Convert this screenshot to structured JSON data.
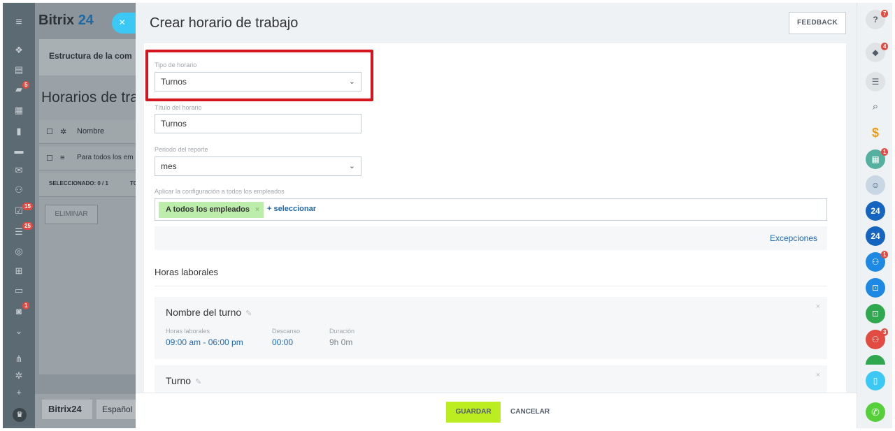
{
  "left_rail": {
    "badges": [
      "5",
      "15",
      "25",
      "1"
    ]
  },
  "background": {
    "logo": "Bitrix",
    "logo_num": "24",
    "close_icon": "×",
    "structure_label": "Estructura de la com",
    "page_title": "Horarios de tra",
    "header_name": "Nombre",
    "row_text": "Para todos los em",
    "selected_text": "SELECCIONADO: 0 / 1",
    "total_text": "TO",
    "delete_button": "ELIMINAR",
    "footer_logo": "Bitrix24",
    "footer_lang": "Español"
  },
  "slider": {
    "title": "Crear horario de trabajo",
    "feedback": "FEEDBACK"
  },
  "form": {
    "schedule_type_label": "Tipo de horario",
    "schedule_type_value": "Turnos",
    "schedule_title_label": "Título del horario",
    "schedule_title_value": "Turnos",
    "report_period_label": "Periodo del reporte",
    "report_period_value": "mes",
    "apply_label": "Aplicar la configuración a todos los empleados",
    "all_employees_tag": "A todos los empleados",
    "select_link": "+ seleccionar",
    "exceptions_link": "Excepciones",
    "working_hours_heading": "Horas laborales"
  },
  "shifts": [
    {
      "name": "Nombre del turno",
      "hours_label": "Horas laborales",
      "hours_value": "09:00 am - 06:00 pm",
      "break_label": "Descanso",
      "break_value": "00:00",
      "duration_label": "Duración",
      "duration_value": "9h 0m"
    },
    {
      "name": "Turno"
    }
  ],
  "footer": {
    "save": "GUARDAR",
    "cancel": "CANCELAR"
  },
  "right_rail": {
    "badges": [
      "7",
      "4",
      "1",
      "1",
      "3"
    ],
    "b24_label": "24"
  },
  "colors": {
    "accent_blue": "#2067b0",
    "save_green": "#bbed21",
    "highlight_red": "#d4141e",
    "tag_green": "#bcedaa"
  }
}
